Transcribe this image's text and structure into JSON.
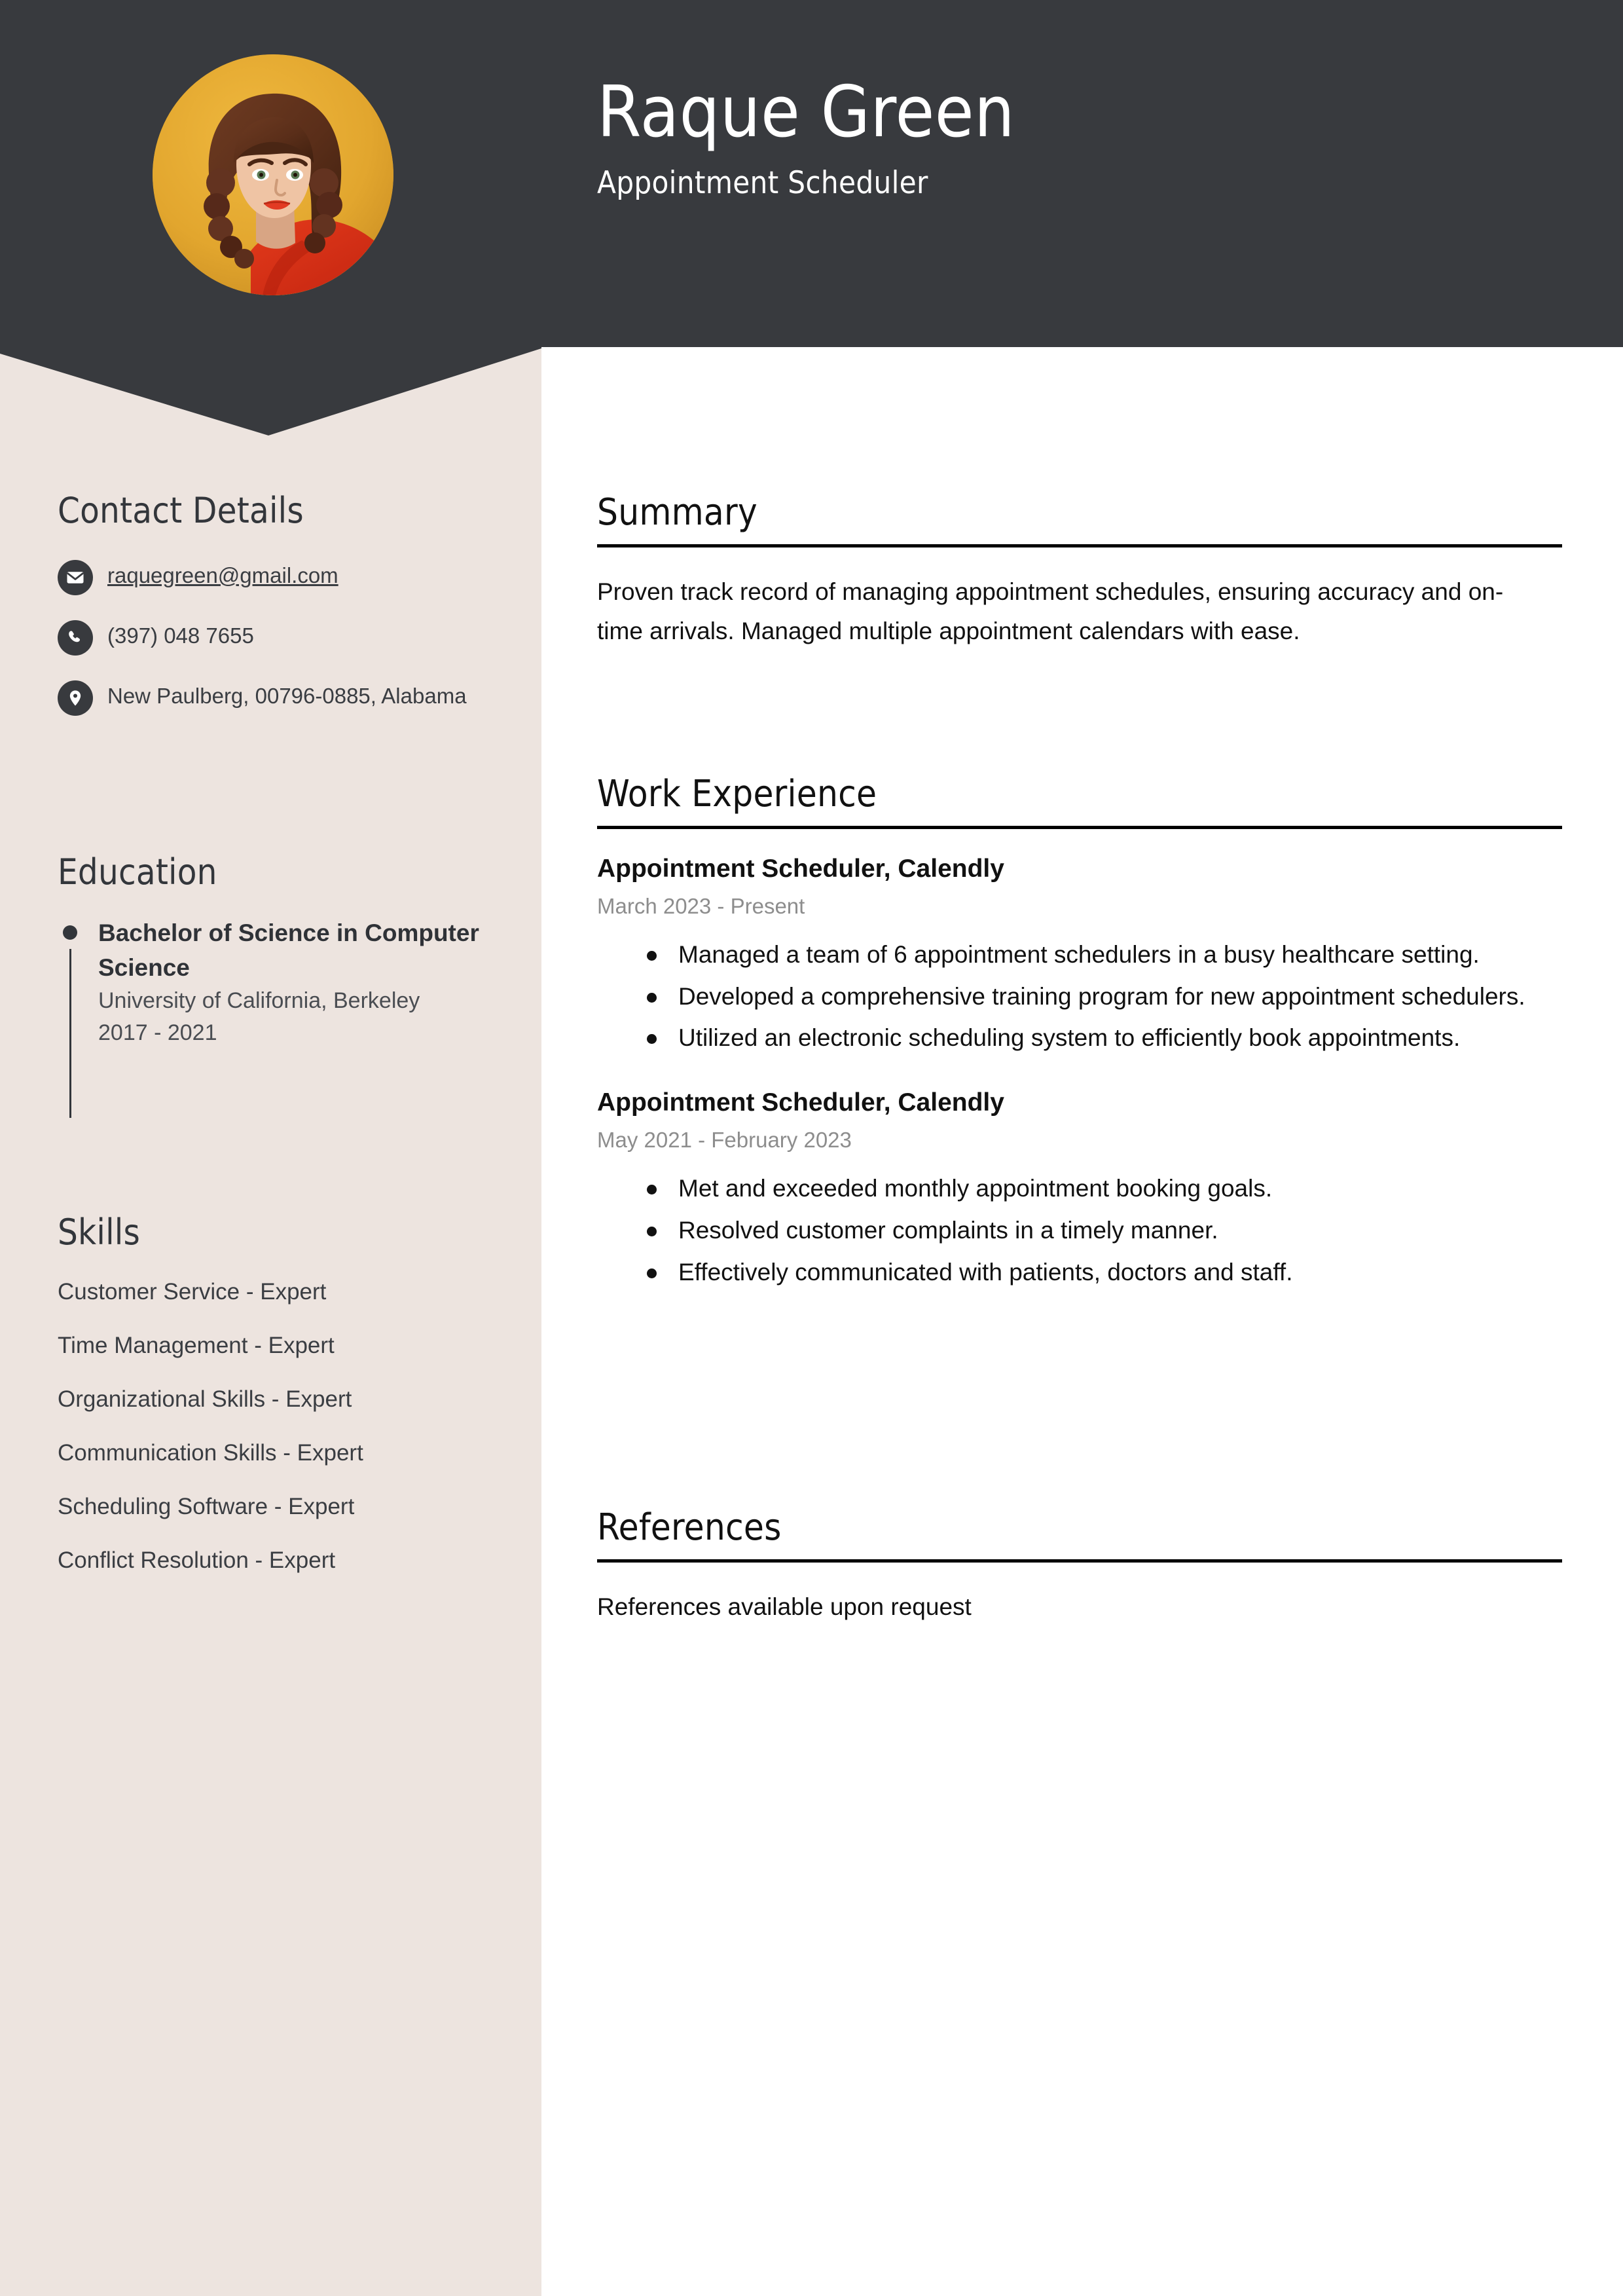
{
  "header": {
    "name": "Raque Green",
    "job_title": "Appointment Scheduler",
    "background_color": "#383A3E",
    "avatar_alt": "portrait-photo"
  },
  "theme": {
    "sidebar_color": "#EDE4DF",
    "dark_color": "#383A3E",
    "accent_photo_bg": "#E0A72E",
    "muted_text_color": "#8D8D8D"
  },
  "sidebar": {
    "contact": {
      "heading": "Contact Details",
      "items": [
        {
          "icon": "envelope-icon",
          "value": "raquegreen@gmail.com",
          "is_link": true
        },
        {
          "icon": "phone-icon",
          "value": "(397) 048 7655",
          "is_link": false
        },
        {
          "icon": "location-pin-icon",
          "value": "New Paulberg, 00796-0885, Alabama",
          "is_link": false
        }
      ]
    },
    "education": {
      "heading": "Education",
      "items": [
        {
          "degree": "Bachelor of Science in Computer Science",
          "school": "University of California, Berkeley",
          "dates": "2017 - 2021"
        }
      ]
    },
    "skills": {
      "heading": "Skills",
      "items": [
        "Customer Service - Expert",
        "Time Management - Expert",
        "Organizational Skills - Expert",
        "Communication Skills - Expert",
        "Scheduling Software - Expert",
        "Conflict Resolution - Expert"
      ]
    }
  },
  "main": {
    "summary": {
      "heading": "Summary",
      "text": "Proven track record of managing appointment schedules, ensuring accuracy and on-time arrivals. Managed multiple appointment calendars with ease."
    },
    "work_experience": {
      "heading": "Work Experience",
      "jobs": [
        {
          "title": "Appointment Scheduler, Calendly",
          "dates": "March 2023 - Present",
          "bullets": [
            "Managed a team of 6 appointment schedulers in a busy healthcare setting.",
            "Developed a comprehensive training program for new appointment schedulers.",
            "Utilized an electronic scheduling system to efficiently book appointments."
          ]
        },
        {
          "title": "Appointment Scheduler, Calendly",
          "dates": "May 2021 - February 2023",
          "bullets": [
            "Met and exceeded monthly appointment booking goals.",
            "Resolved customer complaints in a timely manner.",
            "Effectively communicated with patients, doctors and staff."
          ]
        }
      ]
    },
    "references": {
      "heading": "References",
      "text": "References available upon request"
    }
  }
}
